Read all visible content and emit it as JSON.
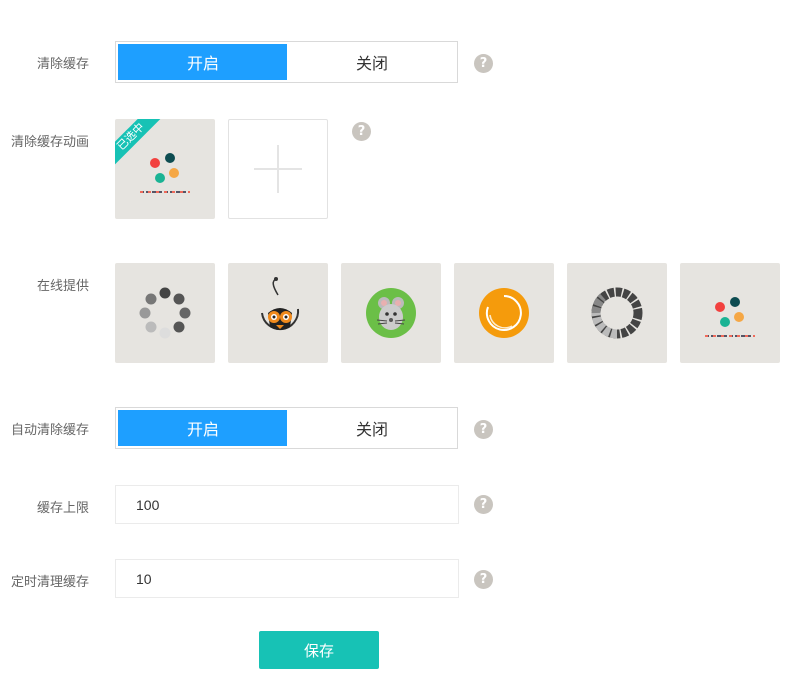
{
  "clear_cache": {
    "label": "清除缓存",
    "on_label": "开启",
    "off_label": "关闭",
    "help": "?"
  },
  "clear_cache_animation": {
    "label": "清除缓存动画",
    "selected_badge": "已选中",
    "help": "?"
  },
  "online": {
    "label": "在线提供",
    "tiles": [
      {
        "icon": "spinner-dots-icon"
      },
      {
        "icon": "owl-icon"
      },
      {
        "icon": "mouse-icon"
      },
      {
        "icon": "orange-ring-icon"
      },
      {
        "icon": "segmented-ring-icon"
      },
      {
        "icon": "colored-dots-icon"
      }
    ]
  },
  "auto_clear": {
    "label": "自动清除缓存",
    "on_label": "开启",
    "off_label": "关闭",
    "help": "?"
  },
  "cache_limit": {
    "label": "缓存上限",
    "value": "100",
    "help": "?"
  },
  "scheduled_clear": {
    "label": "定时清理缓存",
    "value": "10",
    "help": "?"
  },
  "save_label": "保存",
  "colors": {
    "primary": "#1e9fff",
    "accent": "#17c2b5",
    "tile_bg": "#e6e4e0",
    "help_bg": "#c9c5bf"
  }
}
